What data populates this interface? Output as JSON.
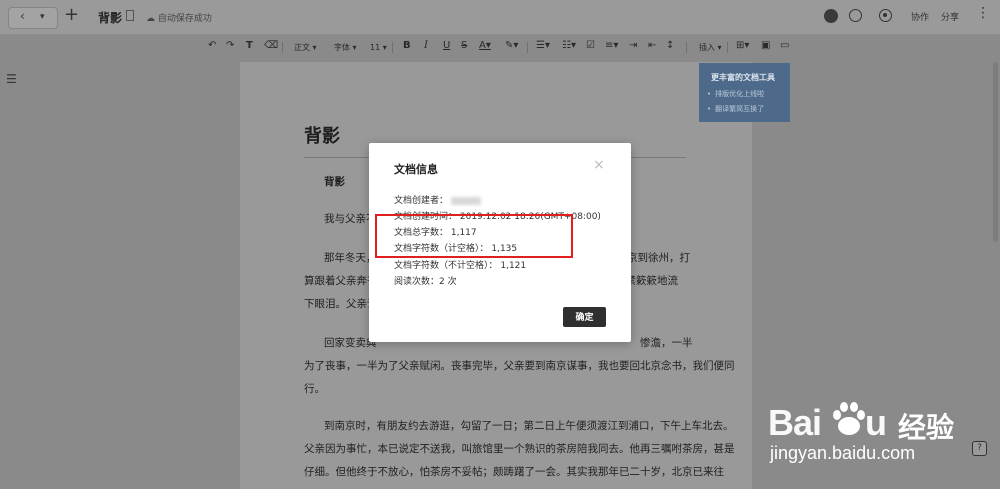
{
  "topbar": {
    "doc_title": "背影",
    "save_status": "自动保存成功",
    "collab_label": "协作",
    "share_label": "分享",
    "more_label": "⋮"
  },
  "toolbar": {
    "style_label": "正文",
    "font_label": "字体",
    "size_label": "11",
    "insert_label": "插入"
  },
  "tip_card": {
    "title": "更丰富的文档工具",
    "items": [
      "排版优化上线啦",
      "翻译繁简互换了"
    ]
  },
  "document": {
    "title": "背影",
    "lines": [
      "背影",
      "我与父亲不",
      "那年冬天，",
      "京到徐州，打",
      "算跟着父亲奔丧回",
      "不禁簌簌地流",
      "下眼泪。父亲说",
      "回家变卖典",
      "惨澹，一半",
      "为了丧事，一半为了父亲赋闲。丧事完毕，父亲要到南京谋事，我也要回北京念书，我们便同",
      "行。",
      "到南京时，有朋友约去游逛，勾留了一日；第二日上午便须渡江到浦口，下午上车北去。",
      "父亲因为事忙，本已说定不送我，叫旅馆里一个熟识的茶房陪我同去。他再三嘱咐茶房，甚是",
      "仔细。但他终于不放心，怕茶房不妥帖；颇踌躇了一会。其实我那年已二十岁，北京已来往"
    ]
  },
  "modal": {
    "title": "文档信息",
    "close_label": "×",
    "creator_label": "文档创建者：",
    "created_time": "文档创建时间：  2019.12.02 18:26(GMT+08:00)",
    "total_words": "文档总字数：   1,117",
    "chars_with_spaces": "文档字符数（计空格）：   1,135",
    "chars_without_spaces": "文档字符数（不计空格）：   1,121",
    "read_count": "阅读次数：2 次",
    "ok_label": "确定"
  },
  "watermark": {
    "logo_text": "Bai",
    "logo_text2": "u",
    "brand_cn": "经验",
    "url": "jingyan.baidu.com"
  },
  "colors": {
    "overlay_gray": "#8a8a8a",
    "highlight_red": "#e02020",
    "button_dark": "#2f2f2f"
  }
}
